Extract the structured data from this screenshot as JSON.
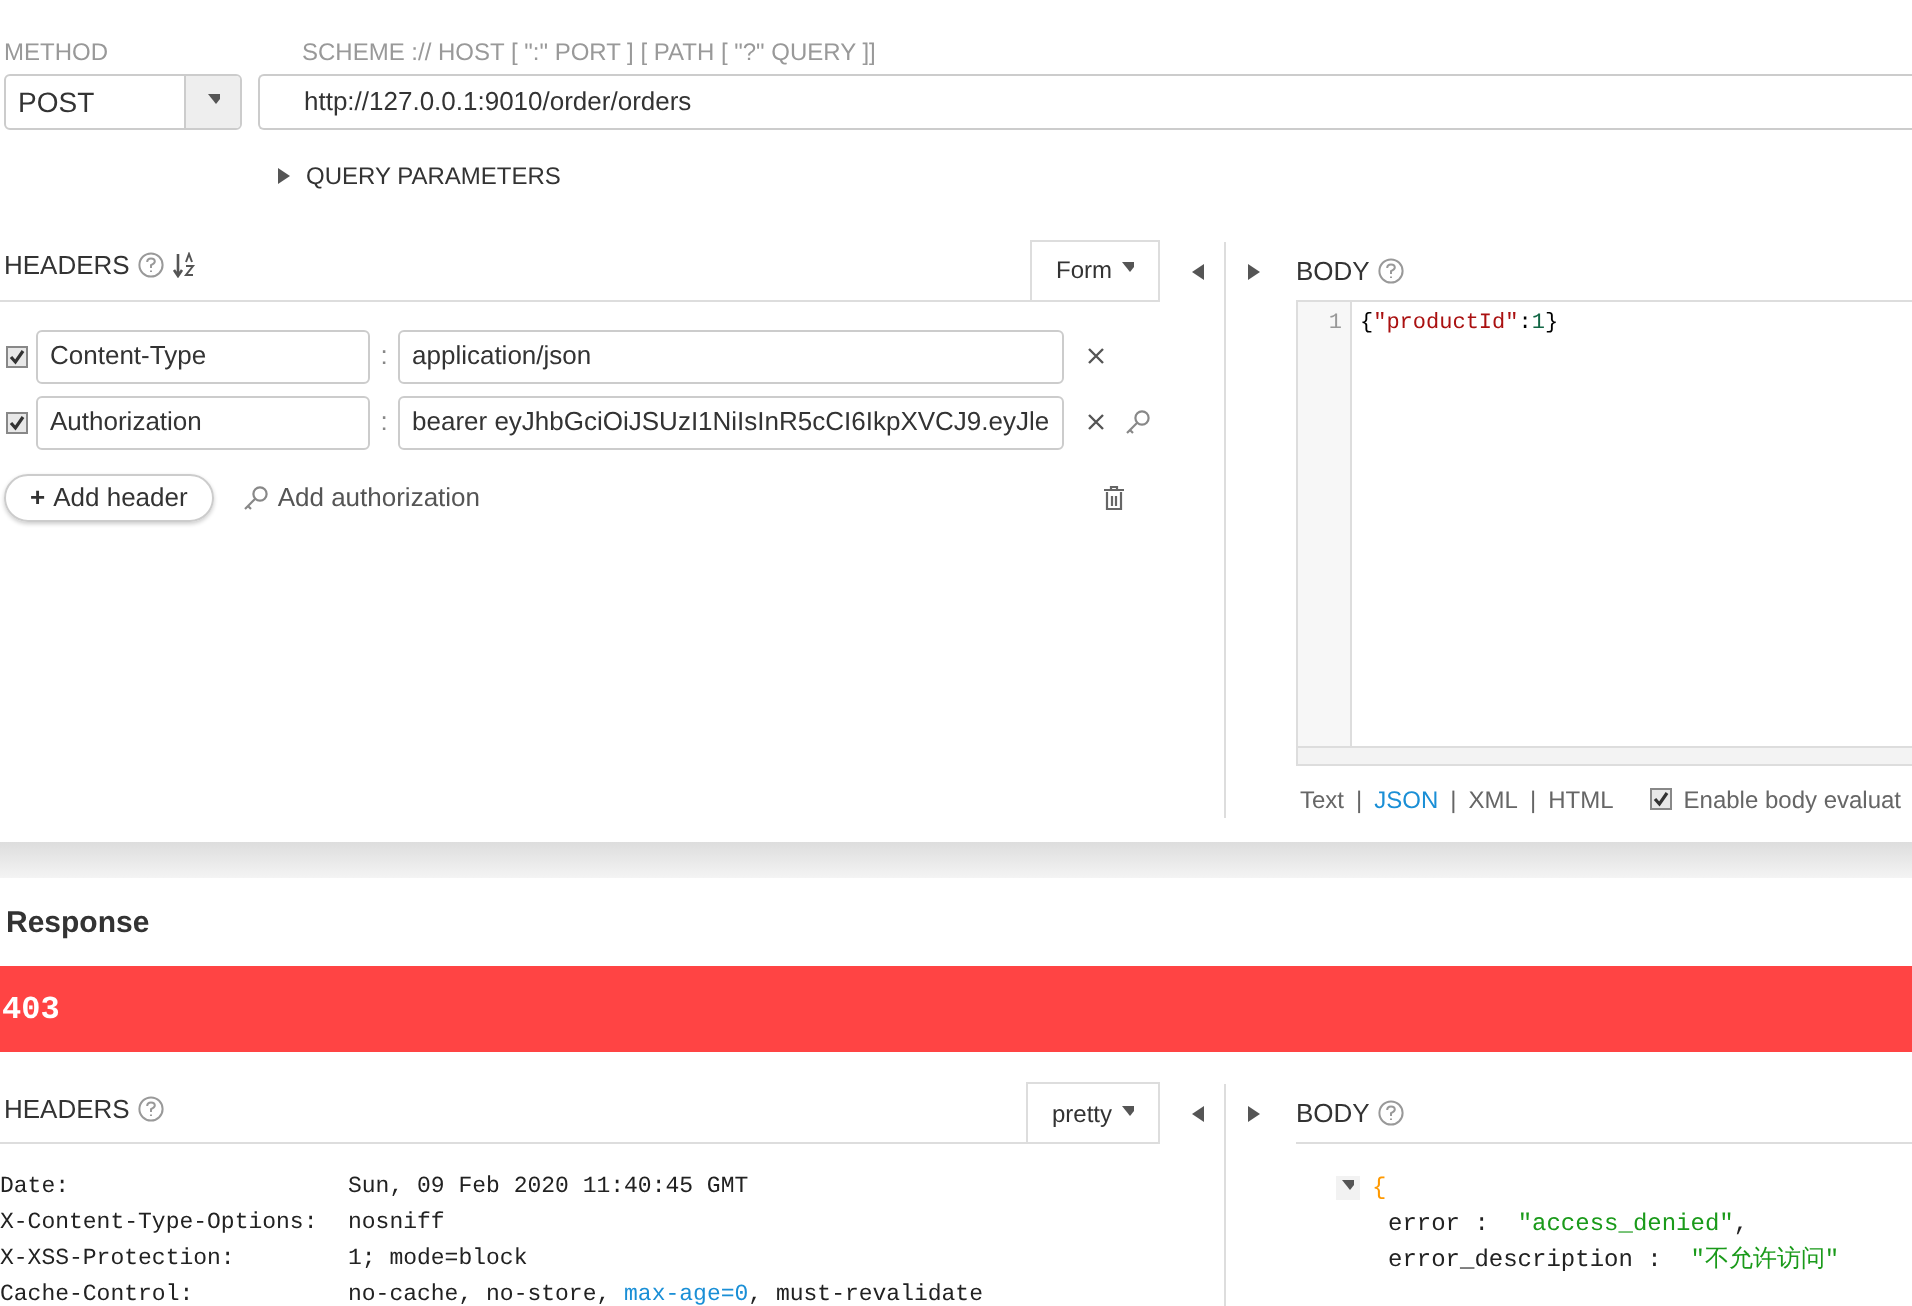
{
  "method": {
    "label": "METHOD",
    "value": "POST"
  },
  "url": {
    "label": "SCHEME :// HOST [ \":\" PORT ] [ PATH [ \"?\" QUERY ]]",
    "value": "http://127.0.0.1:9010/order/orders"
  },
  "query_parameters": {
    "label": "QUERY PARAMETERS",
    "expanded": false
  },
  "request_headers": {
    "title": "HEADERS",
    "mode": "Form",
    "rows": [
      {
        "checked": true,
        "name": "Content-Type",
        "separator": ":",
        "value": "application/json",
        "key_icon": false
      },
      {
        "checked": true,
        "name": "Authorization",
        "separator": ":",
        "value": "bearer eyJhbGciOiJSUzI1NiIsInR5cCI6IkpXVCJ9.eyJle",
        "key_icon": true
      }
    ],
    "add_header": {
      "icon": "+",
      "label": "Add header"
    },
    "add_authorization": "Add authorization"
  },
  "request_body": {
    "title": "BODY",
    "lines": [
      {
        "number": "1",
        "tokens": [
          {
            "kind": "punct",
            "text": "{"
          },
          {
            "kind": "string",
            "text": "\"productId\""
          },
          {
            "kind": "punct",
            "text": ":"
          },
          {
            "kind": "number",
            "text": "1"
          },
          {
            "kind": "punct",
            "text": "}"
          }
        ]
      }
    ],
    "formats": [
      {
        "label": "Text",
        "selected": false
      },
      {
        "label": "JSON",
        "selected": true
      },
      {
        "label": "XML",
        "selected": false
      },
      {
        "label": "HTML",
        "selected": false
      }
    ],
    "format_separator": "|",
    "enable_evaluation": {
      "label": "Enable body evaluat",
      "checked": true
    }
  },
  "response": {
    "title": "Response",
    "status": "403",
    "headers_title": "HEADERS",
    "headers_mode": "pretty",
    "headers": [
      {
        "name": "Date:",
        "parts": [
          {
            "kind": "text",
            "text": "Sun, 09 Feb 2020 11:40:45 GMT"
          }
        ]
      },
      {
        "name": "X-Content-Type-Options:",
        "parts": [
          {
            "kind": "text",
            "text": "nosniff"
          }
        ]
      },
      {
        "name": "X-XSS-Protection:",
        "parts": [
          {
            "kind": "text",
            "text": "1; mode=block"
          }
        ]
      },
      {
        "name": "Cache-Control:",
        "parts": [
          {
            "kind": "text",
            "text": "no-cache, no-store, "
          },
          {
            "kind": "link",
            "text": "max-age=0"
          },
          {
            "kind": "text",
            "text": ", must-revalidate"
          }
        ]
      }
    ],
    "body_title": "BODY",
    "body_expanded": true,
    "body_open": "{",
    "body_entries": [
      {
        "key": "error",
        "colon": ":",
        "value": "\"access_denied\"",
        "comma": ","
      },
      {
        "key": "error_description",
        "colon": ":",
        "value": "\"不允许访问\""
      }
    ]
  }
}
